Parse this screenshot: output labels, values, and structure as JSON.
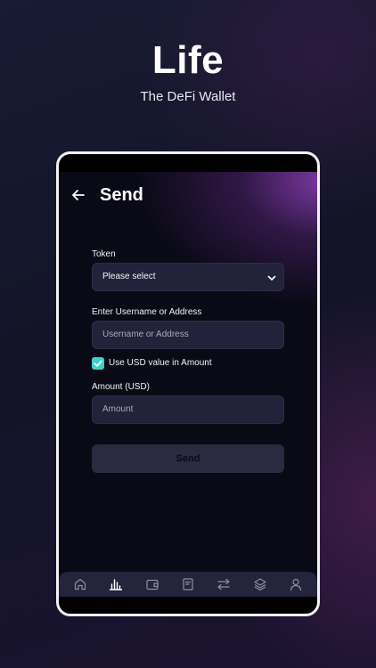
{
  "brand": {
    "title": "Life",
    "subtitle": "The DeFi Wallet"
  },
  "header": {
    "title": "Send",
    "back_icon": "arrow-left-icon"
  },
  "form": {
    "token": {
      "label": "Token",
      "value": "Please select",
      "icon": "chevron-down-icon"
    },
    "recipient": {
      "label": "Enter Username or Address",
      "placeholder": "Username or Address"
    },
    "usd_toggle": {
      "label": "Use USD value in Amount",
      "checked": true,
      "color": "#3fd1c8"
    },
    "amount": {
      "label": "Amount (USD)",
      "placeholder": "Amount"
    },
    "submit_label": "Send"
  },
  "tabbar": {
    "items": [
      {
        "icon": "home-icon"
      },
      {
        "icon": "chart-bars-icon",
        "active": true
      },
      {
        "icon": "wallet-icon"
      },
      {
        "icon": "document-icon"
      },
      {
        "icon": "swap-icon"
      },
      {
        "icon": "layers-icon"
      },
      {
        "icon": "user-icon"
      }
    ]
  },
  "colors": {
    "accent": "#3fd1c8",
    "field_bg": "#22223a",
    "header_glow": "#8a3fb0"
  }
}
